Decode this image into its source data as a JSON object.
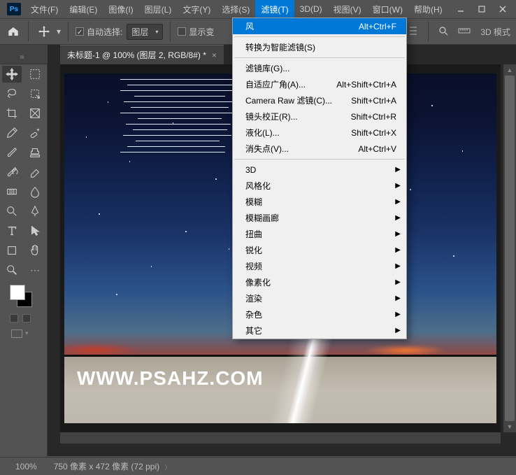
{
  "menubar": {
    "file": "文件(F)",
    "edit": "编辑(E)",
    "image": "图像(I)",
    "layer": "图层(L)",
    "type": "文字(Y)",
    "select": "选择(S)",
    "filter": "滤镜(T)",
    "threeD": "3D(D)",
    "view": "视图(V)",
    "window": "窗口(W)",
    "help": "帮助(H)"
  },
  "optionsbar": {
    "auto_select_label": "自动选择:",
    "auto_select_target": "图层",
    "show_transform_label": "显示变",
    "threeDMode": "3D 模式"
  },
  "tab": {
    "title": "未标题-1 @ 100% (图层 2, RGB/8#) *"
  },
  "dropdown": {
    "last": {
      "label": "风",
      "shortcut": "Alt+Ctrl+F"
    },
    "convert_smart": "转换为智能滤镜(S)",
    "filter_gallery": "滤镜库(G)...",
    "adaptive_wide": {
      "label": "自适应广角(A)...",
      "shortcut": "Alt+Shift+Ctrl+A"
    },
    "camera_raw": {
      "label": "Camera Raw 滤镜(C)...",
      "shortcut": "Shift+Ctrl+A"
    },
    "lens_correction": {
      "label": "镜头校正(R)...",
      "shortcut": "Shift+Ctrl+R"
    },
    "liquify": {
      "label": "液化(L)...",
      "shortcut": "Shift+Ctrl+X"
    },
    "vanishing": {
      "label": "消失点(V)...",
      "shortcut": "Alt+Ctrl+V"
    },
    "sub_3d": "3D",
    "sub_stylize": "风格化",
    "sub_blur": "模糊",
    "sub_blur_gallery": "模糊画廊",
    "sub_distort": "扭曲",
    "sub_sharpen": "锐化",
    "sub_video": "视频",
    "sub_pixelate": "像素化",
    "sub_render": "渲染",
    "sub_noise": "杂色",
    "sub_other": "其它"
  },
  "canvas": {
    "watermark": "WWW.PSAHZ.COM"
  },
  "status": {
    "zoom": "100%",
    "dimensions": "750 像素 x 472 像素 (72 ppi)"
  }
}
